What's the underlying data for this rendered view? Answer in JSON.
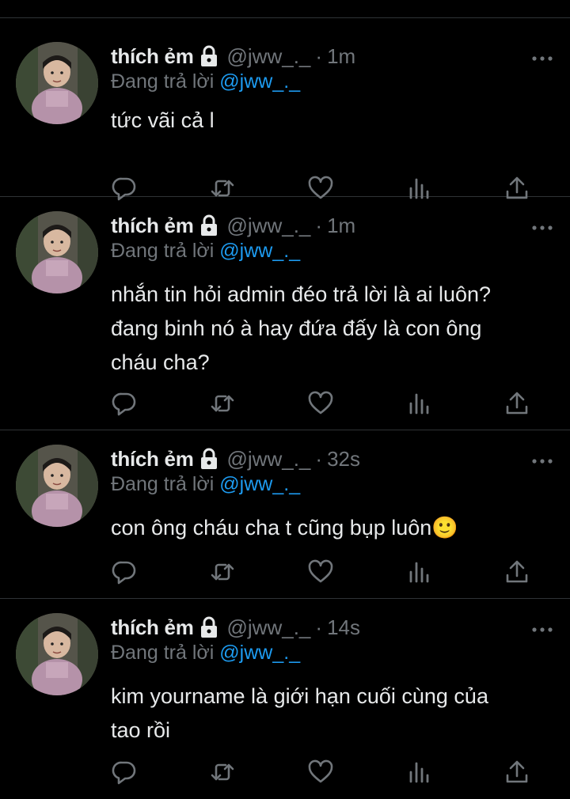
{
  "colors": {
    "background": "#000000",
    "text": "#e7e9ea",
    "muted": "#71767b",
    "accent": "#1d9bf0",
    "divider": "#2f3336"
  },
  "icons": {
    "more": "more-dots-icon",
    "lock": "lock-icon",
    "reply": "reply-icon",
    "retweet": "retweet-icon",
    "like": "heart-icon",
    "views": "analytics-icon",
    "share": "share-icon"
  },
  "tweets": [
    {
      "name": "thích ẻm",
      "handle": "@jww_._",
      "dot": "·",
      "time": "1m",
      "reply_prefix": "Đang trả lời",
      "reply_to": "@jww_._",
      "text": [
        "tức vãi cả l"
      ]
    },
    {
      "name": "thích ẻm",
      "handle": "@jww_._",
      "dot": "·",
      "time": "1m",
      "reply_prefix": "Đang trả lời",
      "reply_to": "@jww_._",
      "text": [
        "nhắn tin hỏi admin đéo trả lời là ai luôn?",
        "đang binh nó à hay đứa đấy là con ông",
        "cháu cha?"
      ]
    },
    {
      "name": "thích ẻm",
      "handle": "@jww_._",
      "dot": "·",
      "time": "32s",
      "reply_prefix": "Đang trả lời",
      "reply_to": "@jww_._",
      "text": [
        "con ông cháu cha t cũng bụp luôn🙂"
      ]
    },
    {
      "name": "thích ẻm",
      "handle": "@jww_._",
      "dot": "·",
      "time": "14s",
      "reply_prefix": "Đang trả lời",
      "reply_to": "@jww_._",
      "text": [
        "kim yourname là giới hạn cuối cùng của",
        "tao rồi"
      ]
    }
  ]
}
